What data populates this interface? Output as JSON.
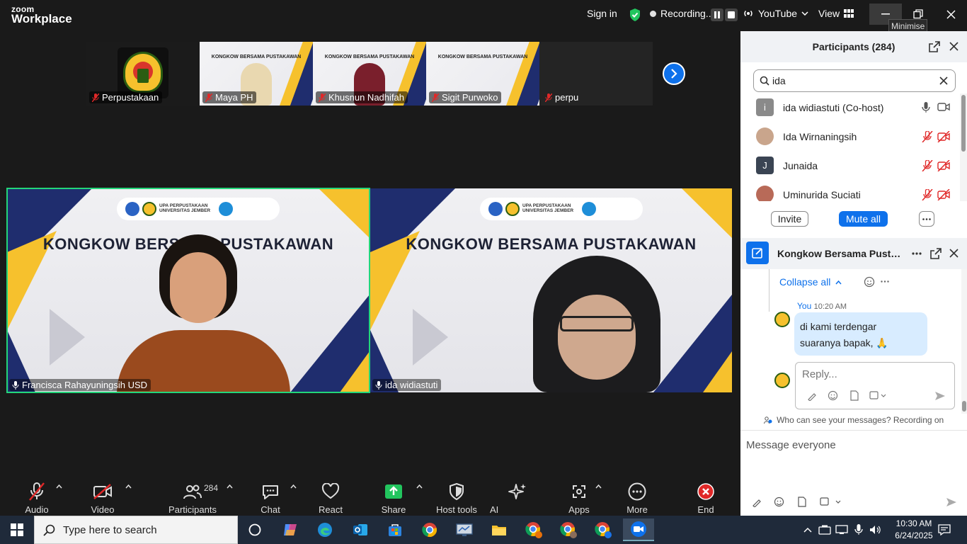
{
  "titlebar": {
    "brand_top": "zoom",
    "brand_bottom": "Workplace",
    "sign_in": "Sign in",
    "recording": "Recording...",
    "youtube": "YouTube",
    "view": "View",
    "minimise_tooltip": "Minimise"
  },
  "thumbnails": [
    {
      "name": "Perpustakaan",
      "kind": "logo"
    },
    {
      "name": "Maya PH",
      "kind": "slide",
      "slide_title": "KONGKOW BERSAMA PUSTAKAWAN"
    },
    {
      "name": "Khusnun Nadhifah",
      "kind": "slide",
      "slide_title": "KONGKOW BERSAMA PUSTAKAWAN"
    },
    {
      "name": "Sigit Purwoko",
      "kind": "slide",
      "slide_title": "KONGKOW BERSAMA PUSTAKAWAN"
    },
    {
      "name": "perpu",
      "kind": "empty"
    }
  ],
  "videos": [
    {
      "name": "Francisca Rahayuningsih USD",
      "slide_title": "KONGKOW BERSAMA PUSTAKAWAN",
      "logo_text": "UPA PERPUSTAKAAN UNIVERSITAS JEMBER",
      "active_speaker": true
    },
    {
      "name": "ida widiastuti",
      "slide_title": "KONGKOW BERSAMA PUSTAKAWAN",
      "logo_text": "UPA PERPUSTAKAAN UNIVERSITAS JEMBER",
      "active_speaker": false
    }
  ],
  "toolbar": {
    "audio": "Audio",
    "video": "Video",
    "participants": "Participants",
    "participants_count": "284",
    "chat": "Chat",
    "react": "React",
    "share": "Share",
    "host_tools": "Host tools",
    "ai_companion": "AI Companion",
    "apps": "Apps",
    "more": "More",
    "end": "End"
  },
  "participants_panel": {
    "title": "Participants (284)",
    "search_value": "ida",
    "list": [
      {
        "initial": "i",
        "name": "ida widiastuti (Co-host)",
        "avatar_color": "#8a8a8a",
        "muted": false
      },
      {
        "initial": "",
        "name": "Ida Wirnaningsih",
        "avatar_color": "#c9a58c",
        "muted": true
      },
      {
        "initial": "J",
        "name": "Junaida",
        "avatar_color": "#3a4453",
        "muted": true
      },
      {
        "initial": "",
        "name": "Uminurida Suciati",
        "avatar_color": "#b86a58",
        "muted": true
      }
    ],
    "invite": "Invite",
    "mute_all": "Mute all"
  },
  "chat_panel": {
    "title": "Kongkow Bersama Pustakawan",
    "collapse_all": "Collapse all",
    "sender": "You",
    "time": "10:20 AM",
    "message_line1": "di kami terdengar",
    "message_line2": "suaranya bapak, 🙏",
    "reply_placeholder": "Reply...",
    "visibility_note": "Who can see your messages? Recording on",
    "input_placeholder": "Message everyone"
  },
  "taskbar": {
    "search_placeholder": "Type here to search",
    "time": "10:30 AM",
    "date": "6/24/2025"
  },
  "colors": {
    "accent": "#0e71eb",
    "speaker_border": "#23d67a",
    "recording_dot": "#e0e0e0",
    "share_green": "#22c55e",
    "muted_red": "#e02828"
  }
}
